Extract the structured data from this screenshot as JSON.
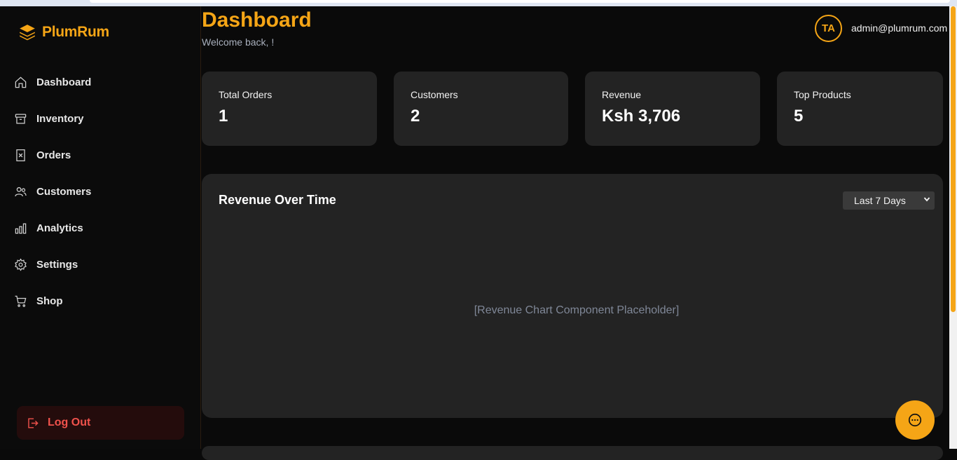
{
  "brand": {
    "name": "PlumRum",
    "accent": "#f5a516"
  },
  "sidebar": {
    "items": [
      {
        "label": "Dashboard",
        "icon": "home-icon"
      },
      {
        "label": "Inventory",
        "icon": "archive-icon"
      },
      {
        "label": "Orders",
        "icon": "receipt-icon"
      },
      {
        "label": "Customers",
        "icon": "users-icon"
      },
      {
        "label": "Analytics",
        "icon": "bar-chart-icon"
      },
      {
        "label": "Settings",
        "icon": "gear-icon"
      },
      {
        "label": "Shop",
        "icon": "cart-icon"
      }
    ],
    "logout_label": "Log Out"
  },
  "header": {
    "title": "Dashboard",
    "subtitle": "Welcome back, !",
    "avatar_initials": "TA",
    "email": "admin@plumrum.com"
  },
  "stats": [
    {
      "label": "Total Orders",
      "value": "1"
    },
    {
      "label": "Customers",
      "value": "2"
    },
    {
      "label": "Revenue",
      "value": "Ksh 3,706"
    },
    {
      "label": "Top Products",
      "value": "5"
    }
  ],
  "chart_card": {
    "title": "Revenue Over Time",
    "range_selected": "Last 7 Days",
    "placeholder": "[Revenue Chart Component Placeholder]"
  }
}
